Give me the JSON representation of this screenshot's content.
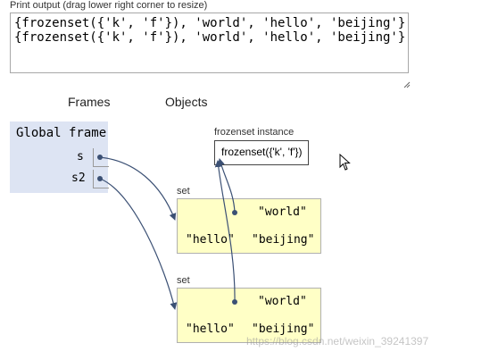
{
  "print_output": {
    "label": "Print output (drag lower right corner to resize)",
    "text": "{frozenset({'k', 'f'}), 'world', 'hello', 'beijing'}\n{frozenset({'k', 'f'}), 'world', 'hello', 'beijing'}"
  },
  "headers": {
    "frames": "Frames",
    "objects": "Objects"
  },
  "global_frame": {
    "title": "Global frame",
    "vars": [
      {
        "name": "s"
      },
      {
        "name": "s2"
      }
    ]
  },
  "objects": {
    "frozenset": {
      "label": "frozenset instance",
      "value": "frozenset({'k', 'f'})"
    },
    "sets": [
      {
        "label": "set",
        "items": [
          "\"world\"",
          "\"hello\"",
          "\"beijing\""
        ]
      },
      {
        "label": "set",
        "items": [
          "\"world\"",
          "\"hello\"",
          "\"beijing\""
        ]
      }
    ]
  },
  "icons": {
    "resize": "resize-grip-icon",
    "cursor": "mouse-cursor-icon"
  },
  "colors": {
    "frame_bg": "#dde4f3",
    "set_bg": "#ffffc6",
    "arrow": "#3b5074"
  },
  "watermark": "https://blog.csdn.net/weixin_39241397"
}
